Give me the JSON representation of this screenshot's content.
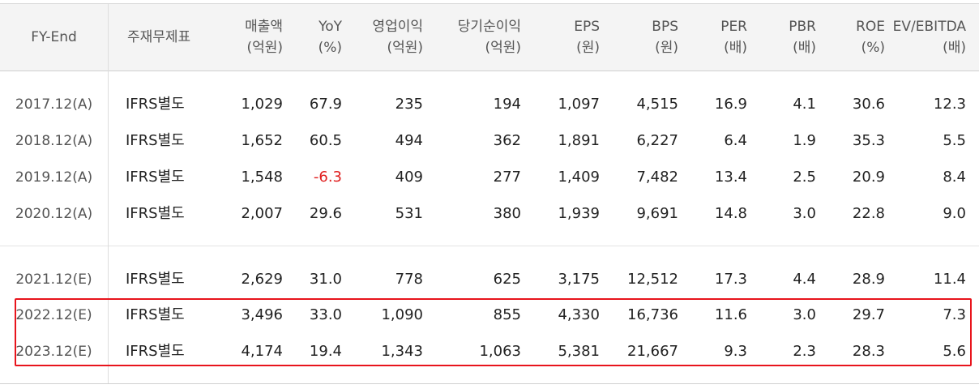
{
  "columns": [
    {
      "label": "FY-End",
      "unit": ""
    },
    {
      "label": "주재무제표",
      "unit": ""
    },
    {
      "label": "매출액",
      "unit": "(억원)"
    },
    {
      "label": "YoY",
      "unit": "(%)"
    },
    {
      "label": "영업이익",
      "unit": "(억원)"
    },
    {
      "label": "당기순이익",
      "unit": "(억원)"
    },
    {
      "label": "EPS",
      "unit": "(원)"
    },
    {
      "label": "BPS",
      "unit": "(원)"
    },
    {
      "label": "PER",
      "unit": "(배)"
    },
    {
      "label": "PBR",
      "unit": "(배)"
    },
    {
      "label": "ROE",
      "unit": "(%)"
    },
    {
      "label": "EV/EBITDA",
      "unit": "(배)"
    }
  ],
  "rows": [
    [
      "2017.12(A)",
      "IFRS별도",
      "1,029",
      "67.9",
      "235",
      "194",
      "1,097",
      "4,515",
      "16.9",
      "4.1",
      "30.6",
      "12.3"
    ],
    [
      "2018.12(A)",
      "IFRS별도",
      "1,652",
      "60.5",
      "494",
      "362",
      "1,891",
      "6,227",
      "6.4",
      "1.9",
      "35.3",
      "5.5"
    ],
    [
      "2019.12(A)",
      "IFRS별도",
      "1,548",
      "-6.3",
      "409",
      "277",
      "1,409",
      "7,482",
      "13.4",
      "2.5",
      "20.9",
      "8.4"
    ],
    [
      "2020.12(A)",
      "IFRS별도",
      "2,007",
      "29.6",
      "531",
      "380",
      "1,939",
      "9,691",
      "14.8",
      "3.0",
      "22.8",
      "9.0"
    ],
    [
      "2021.12(E)",
      "IFRS별도",
      "2,629",
      "31.0",
      "778",
      "625",
      "3,175",
      "12,512",
      "17.3",
      "4.4",
      "28.9",
      "11.4"
    ],
    [
      "2022.12(E)",
      "IFRS별도",
      "3,496",
      "33.0",
      "1,090",
      "855",
      "4,330",
      "16,736",
      "11.6",
      "3.0",
      "29.7",
      "7.3"
    ],
    [
      "2023.12(E)",
      "IFRS별도",
      "4,174",
      "19.4",
      "1,343",
      "1,063",
      "5,381",
      "21,667",
      "9.3",
      "2.3",
      "28.3",
      "5.6"
    ]
  ],
  "colors": {
    "negative": "#e02020",
    "highlight_border": "#e8141c",
    "header_bg": "#f4f4f4"
  }
}
